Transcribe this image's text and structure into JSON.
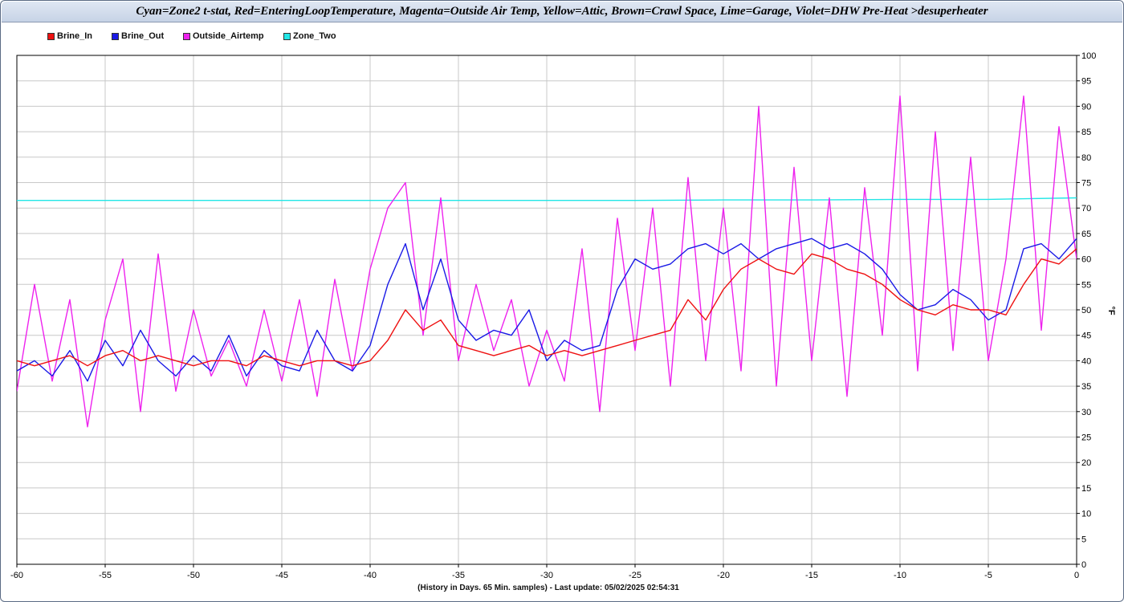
{
  "title": "Cyan=Zone2 t-stat, Red=EnteringLoopTemperature, Magenta=Outside Air Temp, Yellow=Attic, Brown=Crawl Space, Lime=Garage, Violet=DHW Pre-Heat >desuperheater",
  "footer": "(History in Days. 65 Min. samples) - Last update: 05/02/2025 02:54:31",
  "colors": {
    "brine_in": "#ee1111",
    "brine_out": "#1a1ae6",
    "outside": "#ee22ee",
    "zone_two": "#22e6e6"
  },
  "chart_data": {
    "type": "line",
    "title": "Cyan=Zone2 t-stat, Red=EnteringLoopTemperature, Magenta=Outside Air Temp, Yellow=Attic, Brown=Crawl Space, Lime=Garage, Violet=DHW Pre-Heat >desuperheater",
    "xlabel": "(History in Days. 65 Min. samples) - Last update: 05/02/2025 02:54:31",
    "ylabel": "°F",
    "xlim": [
      -60,
      0
    ],
    "ylim": [
      0,
      100
    ],
    "x_ticks": [
      -60,
      -55,
      -50,
      -45,
      -40,
      -35,
      -30,
      -25,
      -20,
      -15,
      -10,
      -5,
      0
    ],
    "y_ticks": [
      0,
      5,
      10,
      15,
      20,
      25,
      30,
      35,
      40,
      45,
      50,
      55,
      60,
      65,
      70,
      75,
      80,
      85,
      90,
      95,
      100
    ],
    "grid": true,
    "legend_position": "top-left",
    "y_axis_side": "right",
    "series": [
      {
        "name": "Brine_In",
        "color": "#ee1111",
        "x": [
          -60,
          -59,
          -58,
          -57,
          -56,
          -55,
          -54,
          -53,
          -52,
          -51,
          -50,
          -49,
          -48,
          -47,
          -46,
          -45,
          -44,
          -43,
          -42,
          -41,
          -40,
          -39,
          -38,
          -37,
          -36,
          -35,
          -34,
          -33,
          -32,
          -31,
          -30,
          -29,
          -28,
          -27,
          -26,
          -25,
          -24,
          -23,
          -22,
          -21,
          -20,
          -19,
          -18,
          -17,
          -16,
          -15,
          -14,
          -13,
          -12,
          -11,
          -10,
          -9,
          -8,
          -7,
          -6,
          -5,
          -4,
          -3,
          -2,
          -1,
          0
        ],
        "y": [
          40,
          39,
          40,
          41,
          39,
          41,
          42,
          40,
          41,
          40,
          39,
          40,
          40,
          39,
          41,
          40,
          39,
          40,
          40,
          39,
          40,
          44,
          50,
          46,
          48,
          43,
          42,
          41,
          42,
          43,
          41,
          42,
          41,
          42,
          43,
          44,
          45,
          46,
          52,
          48,
          54,
          58,
          60,
          58,
          57,
          61,
          60,
          58,
          57,
          55,
          52,
          50,
          49,
          51,
          50,
          50,
          49,
          55,
          60,
          59,
          62
        ]
      },
      {
        "name": "Brine_Out",
        "color": "#1a1ae6",
        "x": [
          -60,
          -59,
          -58,
          -57,
          -56,
          -55,
          -54,
          -53,
          -52,
          -51,
          -50,
          -49,
          -48,
          -47,
          -46,
          -45,
          -44,
          -43,
          -42,
          -41,
          -40,
          -39,
          -38,
          -37,
          -36,
          -35,
          -34,
          -33,
          -32,
          -31,
          -30,
          -29,
          -28,
          -27,
          -26,
          -25,
          -24,
          -23,
          -22,
          -21,
          -20,
          -19,
          -18,
          -17,
          -16,
          -15,
          -14,
          -13,
          -12,
          -11,
          -10,
          -9,
          -8,
          -7,
          -6,
          -5,
          -4,
          -3,
          -2,
          -1,
          0
        ],
        "y": [
          38,
          40,
          37,
          42,
          36,
          44,
          39,
          46,
          40,
          37,
          41,
          38,
          45,
          37,
          42,
          39,
          38,
          46,
          40,
          38,
          43,
          55,
          63,
          50,
          60,
          48,
          44,
          46,
          45,
          50,
          40,
          44,
          42,
          43,
          54,
          60,
          58,
          59,
          62,
          63,
          61,
          63,
          60,
          62,
          63,
          64,
          62,
          63,
          61,
          58,
          53,
          50,
          51,
          54,
          52,
          48,
          50,
          62,
          63,
          60,
          64
        ]
      },
      {
        "name": "Outside_Airtemp",
        "color": "#ee22ee",
        "x": [
          -60,
          -59,
          -58,
          -57,
          -56,
          -55,
          -54,
          -53,
          -52,
          -51,
          -50,
          -49,
          -48,
          -47,
          -46,
          -45,
          -44,
          -43,
          -42,
          -41,
          -40,
          -39,
          -38,
          -37,
          -36,
          -35,
          -34,
          -33,
          -32,
          -31,
          -30,
          -29,
          -28,
          -27,
          -26,
          -25,
          -24,
          -23,
          -22,
          -21,
          -20,
          -19,
          -18,
          -17,
          -16,
          -15,
          -14,
          -13,
          -12,
          -11,
          -10,
          -9,
          -8,
          -7,
          -6,
          -5,
          -4,
          -3,
          -2,
          -1,
          0
        ],
        "y": [
          34,
          55,
          36,
          52,
          27,
          48,
          60,
          30,
          61,
          34,
          50,
          37,
          44,
          35,
          50,
          36,
          52,
          33,
          56,
          38,
          58,
          70,
          75,
          45,
          72,
          40,
          55,
          42,
          52,
          35,
          46,
          36,
          62,
          30,
          68,
          42,
          70,
          35,
          76,
          40,
          70,
          38,
          90,
          35,
          78,
          40,
          72,
          33,
          74,
          45,
          92,
          38,
          85,
          42,
          80,
          40,
          60,
          92,
          46,
          86,
          60
        ]
      },
      {
        "name": "Zone_Two",
        "color": "#22e6e6",
        "x": [
          -60,
          -55,
          -50,
          -45,
          -40,
          -35,
          -30,
          -25,
          -20,
          -15,
          -10,
          -5,
          0
        ],
        "y": [
          71.5,
          71.5,
          71.5,
          71.5,
          71.5,
          71.5,
          71.5,
          71.5,
          71.6,
          71.6,
          71.7,
          71.7,
          72
        ]
      }
    ]
  },
  "legend": [
    {
      "label": "Brine_In",
      "color": "#ee1111"
    },
    {
      "label": "Brine_Out",
      "color": "#1a1ae6"
    },
    {
      "label": "Outside_Airtemp",
      "color": "#ee22ee"
    },
    {
      "label": "Zone_Two",
      "color": "#22e6e6"
    }
  ]
}
